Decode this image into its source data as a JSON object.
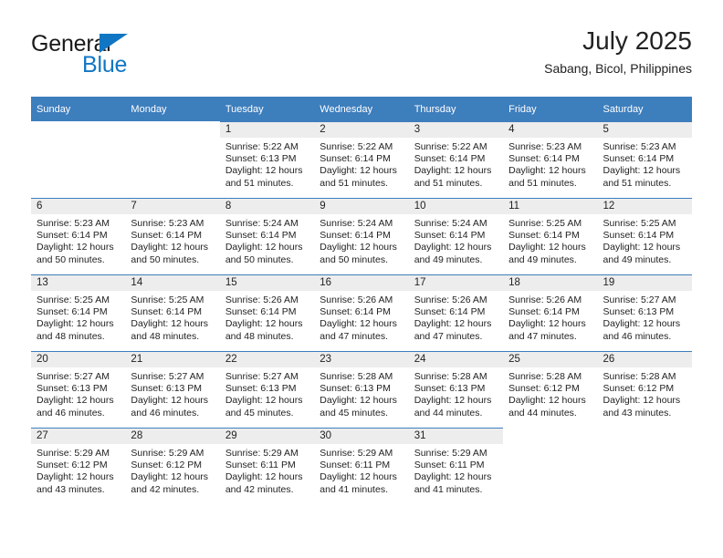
{
  "brand": {
    "line1": "General",
    "line2": "Blue",
    "accent_color": "#1076c4"
  },
  "header": {
    "title": "July 2025",
    "subtitle": "Sabang, Bicol, Philippines"
  },
  "theme": {
    "header_bar_color": "#3d7ebd",
    "day_band_color": "#ededed",
    "text_color": "#222222"
  },
  "weekday_headers": [
    "Sunday",
    "Monday",
    "Tuesday",
    "Wednesday",
    "Thursday",
    "Friday",
    "Saturday"
  ],
  "labels": {
    "sunrise_prefix": "Sunrise:",
    "sunset_prefix": "Sunset:",
    "daylight_prefix": "Daylight:"
  },
  "weeks": [
    [
      {
        "day": "",
        "sunrise": "",
        "sunset": "",
        "daylight_a": "",
        "daylight_b": ""
      },
      {
        "day": "",
        "sunrise": "",
        "sunset": "",
        "daylight_a": "",
        "daylight_b": ""
      },
      {
        "day": "1",
        "sunrise": "Sunrise: 5:22 AM",
        "sunset": "Sunset: 6:13 PM",
        "daylight_a": "Daylight: 12 hours",
        "daylight_b": "and 51 minutes."
      },
      {
        "day": "2",
        "sunrise": "Sunrise: 5:22 AM",
        "sunset": "Sunset: 6:14 PM",
        "daylight_a": "Daylight: 12 hours",
        "daylight_b": "and 51 minutes."
      },
      {
        "day": "3",
        "sunrise": "Sunrise: 5:22 AM",
        "sunset": "Sunset: 6:14 PM",
        "daylight_a": "Daylight: 12 hours",
        "daylight_b": "and 51 minutes."
      },
      {
        "day": "4",
        "sunrise": "Sunrise: 5:23 AM",
        "sunset": "Sunset: 6:14 PM",
        "daylight_a": "Daylight: 12 hours",
        "daylight_b": "and 51 minutes."
      },
      {
        "day": "5",
        "sunrise": "Sunrise: 5:23 AM",
        "sunset": "Sunset: 6:14 PM",
        "daylight_a": "Daylight: 12 hours",
        "daylight_b": "and 51 minutes."
      }
    ],
    [
      {
        "day": "6",
        "sunrise": "Sunrise: 5:23 AM",
        "sunset": "Sunset: 6:14 PM",
        "daylight_a": "Daylight: 12 hours",
        "daylight_b": "and 50 minutes."
      },
      {
        "day": "7",
        "sunrise": "Sunrise: 5:23 AM",
        "sunset": "Sunset: 6:14 PM",
        "daylight_a": "Daylight: 12 hours",
        "daylight_b": "and 50 minutes."
      },
      {
        "day": "8",
        "sunrise": "Sunrise: 5:24 AM",
        "sunset": "Sunset: 6:14 PM",
        "daylight_a": "Daylight: 12 hours",
        "daylight_b": "and 50 minutes."
      },
      {
        "day": "9",
        "sunrise": "Sunrise: 5:24 AM",
        "sunset": "Sunset: 6:14 PM",
        "daylight_a": "Daylight: 12 hours",
        "daylight_b": "and 50 minutes."
      },
      {
        "day": "10",
        "sunrise": "Sunrise: 5:24 AM",
        "sunset": "Sunset: 6:14 PM",
        "daylight_a": "Daylight: 12 hours",
        "daylight_b": "and 49 minutes."
      },
      {
        "day": "11",
        "sunrise": "Sunrise: 5:25 AM",
        "sunset": "Sunset: 6:14 PM",
        "daylight_a": "Daylight: 12 hours",
        "daylight_b": "and 49 minutes."
      },
      {
        "day": "12",
        "sunrise": "Sunrise: 5:25 AM",
        "sunset": "Sunset: 6:14 PM",
        "daylight_a": "Daylight: 12 hours",
        "daylight_b": "and 49 minutes."
      }
    ],
    [
      {
        "day": "13",
        "sunrise": "Sunrise: 5:25 AM",
        "sunset": "Sunset: 6:14 PM",
        "daylight_a": "Daylight: 12 hours",
        "daylight_b": "and 48 minutes."
      },
      {
        "day": "14",
        "sunrise": "Sunrise: 5:25 AM",
        "sunset": "Sunset: 6:14 PM",
        "daylight_a": "Daylight: 12 hours",
        "daylight_b": "and 48 minutes."
      },
      {
        "day": "15",
        "sunrise": "Sunrise: 5:26 AM",
        "sunset": "Sunset: 6:14 PM",
        "daylight_a": "Daylight: 12 hours",
        "daylight_b": "and 48 minutes."
      },
      {
        "day": "16",
        "sunrise": "Sunrise: 5:26 AM",
        "sunset": "Sunset: 6:14 PM",
        "daylight_a": "Daylight: 12 hours",
        "daylight_b": "and 47 minutes."
      },
      {
        "day": "17",
        "sunrise": "Sunrise: 5:26 AM",
        "sunset": "Sunset: 6:14 PM",
        "daylight_a": "Daylight: 12 hours",
        "daylight_b": "and 47 minutes."
      },
      {
        "day": "18",
        "sunrise": "Sunrise: 5:26 AM",
        "sunset": "Sunset: 6:14 PM",
        "daylight_a": "Daylight: 12 hours",
        "daylight_b": "and 47 minutes."
      },
      {
        "day": "19",
        "sunrise": "Sunrise: 5:27 AM",
        "sunset": "Sunset: 6:13 PM",
        "daylight_a": "Daylight: 12 hours",
        "daylight_b": "and 46 minutes."
      }
    ],
    [
      {
        "day": "20",
        "sunrise": "Sunrise: 5:27 AM",
        "sunset": "Sunset: 6:13 PM",
        "daylight_a": "Daylight: 12 hours",
        "daylight_b": "and 46 minutes."
      },
      {
        "day": "21",
        "sunrise": "Sunrise: 5:27 AM",
        "sunset": "Sunset: 6:13 PM",
        "daylight_a": "Daylight: 12 hours",
        "daylight_b": "and 46 minutes."
      },
      {
        "day": "22",
        "sunrise": "Sunrise: 5:27 AM",
        "sunset": "Sunset: 6:13 PM",
        "daylight_a": "Daylight: 12 hours",
        "daylight_b": "and 45 minutes."
      },
      {
        "day": "23",
        "sunrise": "Sunrise: 5:28 AM",
        "sunset": "Sunset: 6:13 PM",
        "daylight_a": "Daylight: 12 hours",
        "daylight_b": "and 45 minutes."
      },
      {
        "day": "24",
        "sunrise": "Sunrise: 5:28 AM",
        "sunset": "Sunset: 6:13 PM",
        "daylight_a": "Daylight: 12 hours",
        "daylight_b": "and 44 minutes."
      },
      {
        "day": "25",
        "sunrise": "Sunrise: 5:28 AM",
        "sunset": "Sunset: 6:12 PM",
        "daylight_a": "Daylight: 12 hours",
        "daylight_b": "and 44 minutes."
      },
      {
        "day": "26",
        "sunrise": "Sunrise: 5:28 AM",
        "sunset": "Sunset: 6:12 PM",
        "daylight_a": "Daylight: 12 hours",
        "daylight_b": "and 43 minutes."
      }
    ],
    [
      {
        "day": "27",
        "sunrise": "Sunrise: 5:29 AM",
        "sunset": "Sunset: 6:12 PM",
        "daylight_a": "Daylight: 12 hours",
        "daylight_b": "and 43 minutes."
      },
      {
        "day": "28",
        "sunrise": "Sunrise: 5:29 AM",
        "sunset": "Sunset: 6:12 PM",
        "daylight_a": "Daylight: 12 hours",
        "daylight_b": "and 42 minutes."
      },
      {
        "day": "29",
        "sunrise": "Sunrise: 5:29 AM",
        "sunset": "Sunset: 6:11 PM",
        "daylight_a": "Daylight: 12 hours",
        "daylight_b": "and 42 minutes."
      },
      {
        "day": "30",
        "sunrise": "Sunrise: 5:29 AM",
        "sunset": "Sunset: 6:11 PM",
        "daylight_a": "Daylight: 12 hours",
        "daylight_b": "and 41 minutes."
      },
      {
        "day": "31",
        "sunrise": "Sunrise: 5:29 AM",
        "sunset": "Sunset: 6:11 PM",
        "daylight_a": "Daylight: 12 hours",
        "daylight_b": "and 41 minutes."
      },
      {
        "day": "",
        "sunrise": "",
        "sunset": "",
        "daylight_a": "",
        "daylight_b": ""
      },
      {
        "day": "",
        "sunrise": "",
        "sunset": "",
        "daylight_a": "",
        "daylight_b": ""
      }
    ]
  ]
}
